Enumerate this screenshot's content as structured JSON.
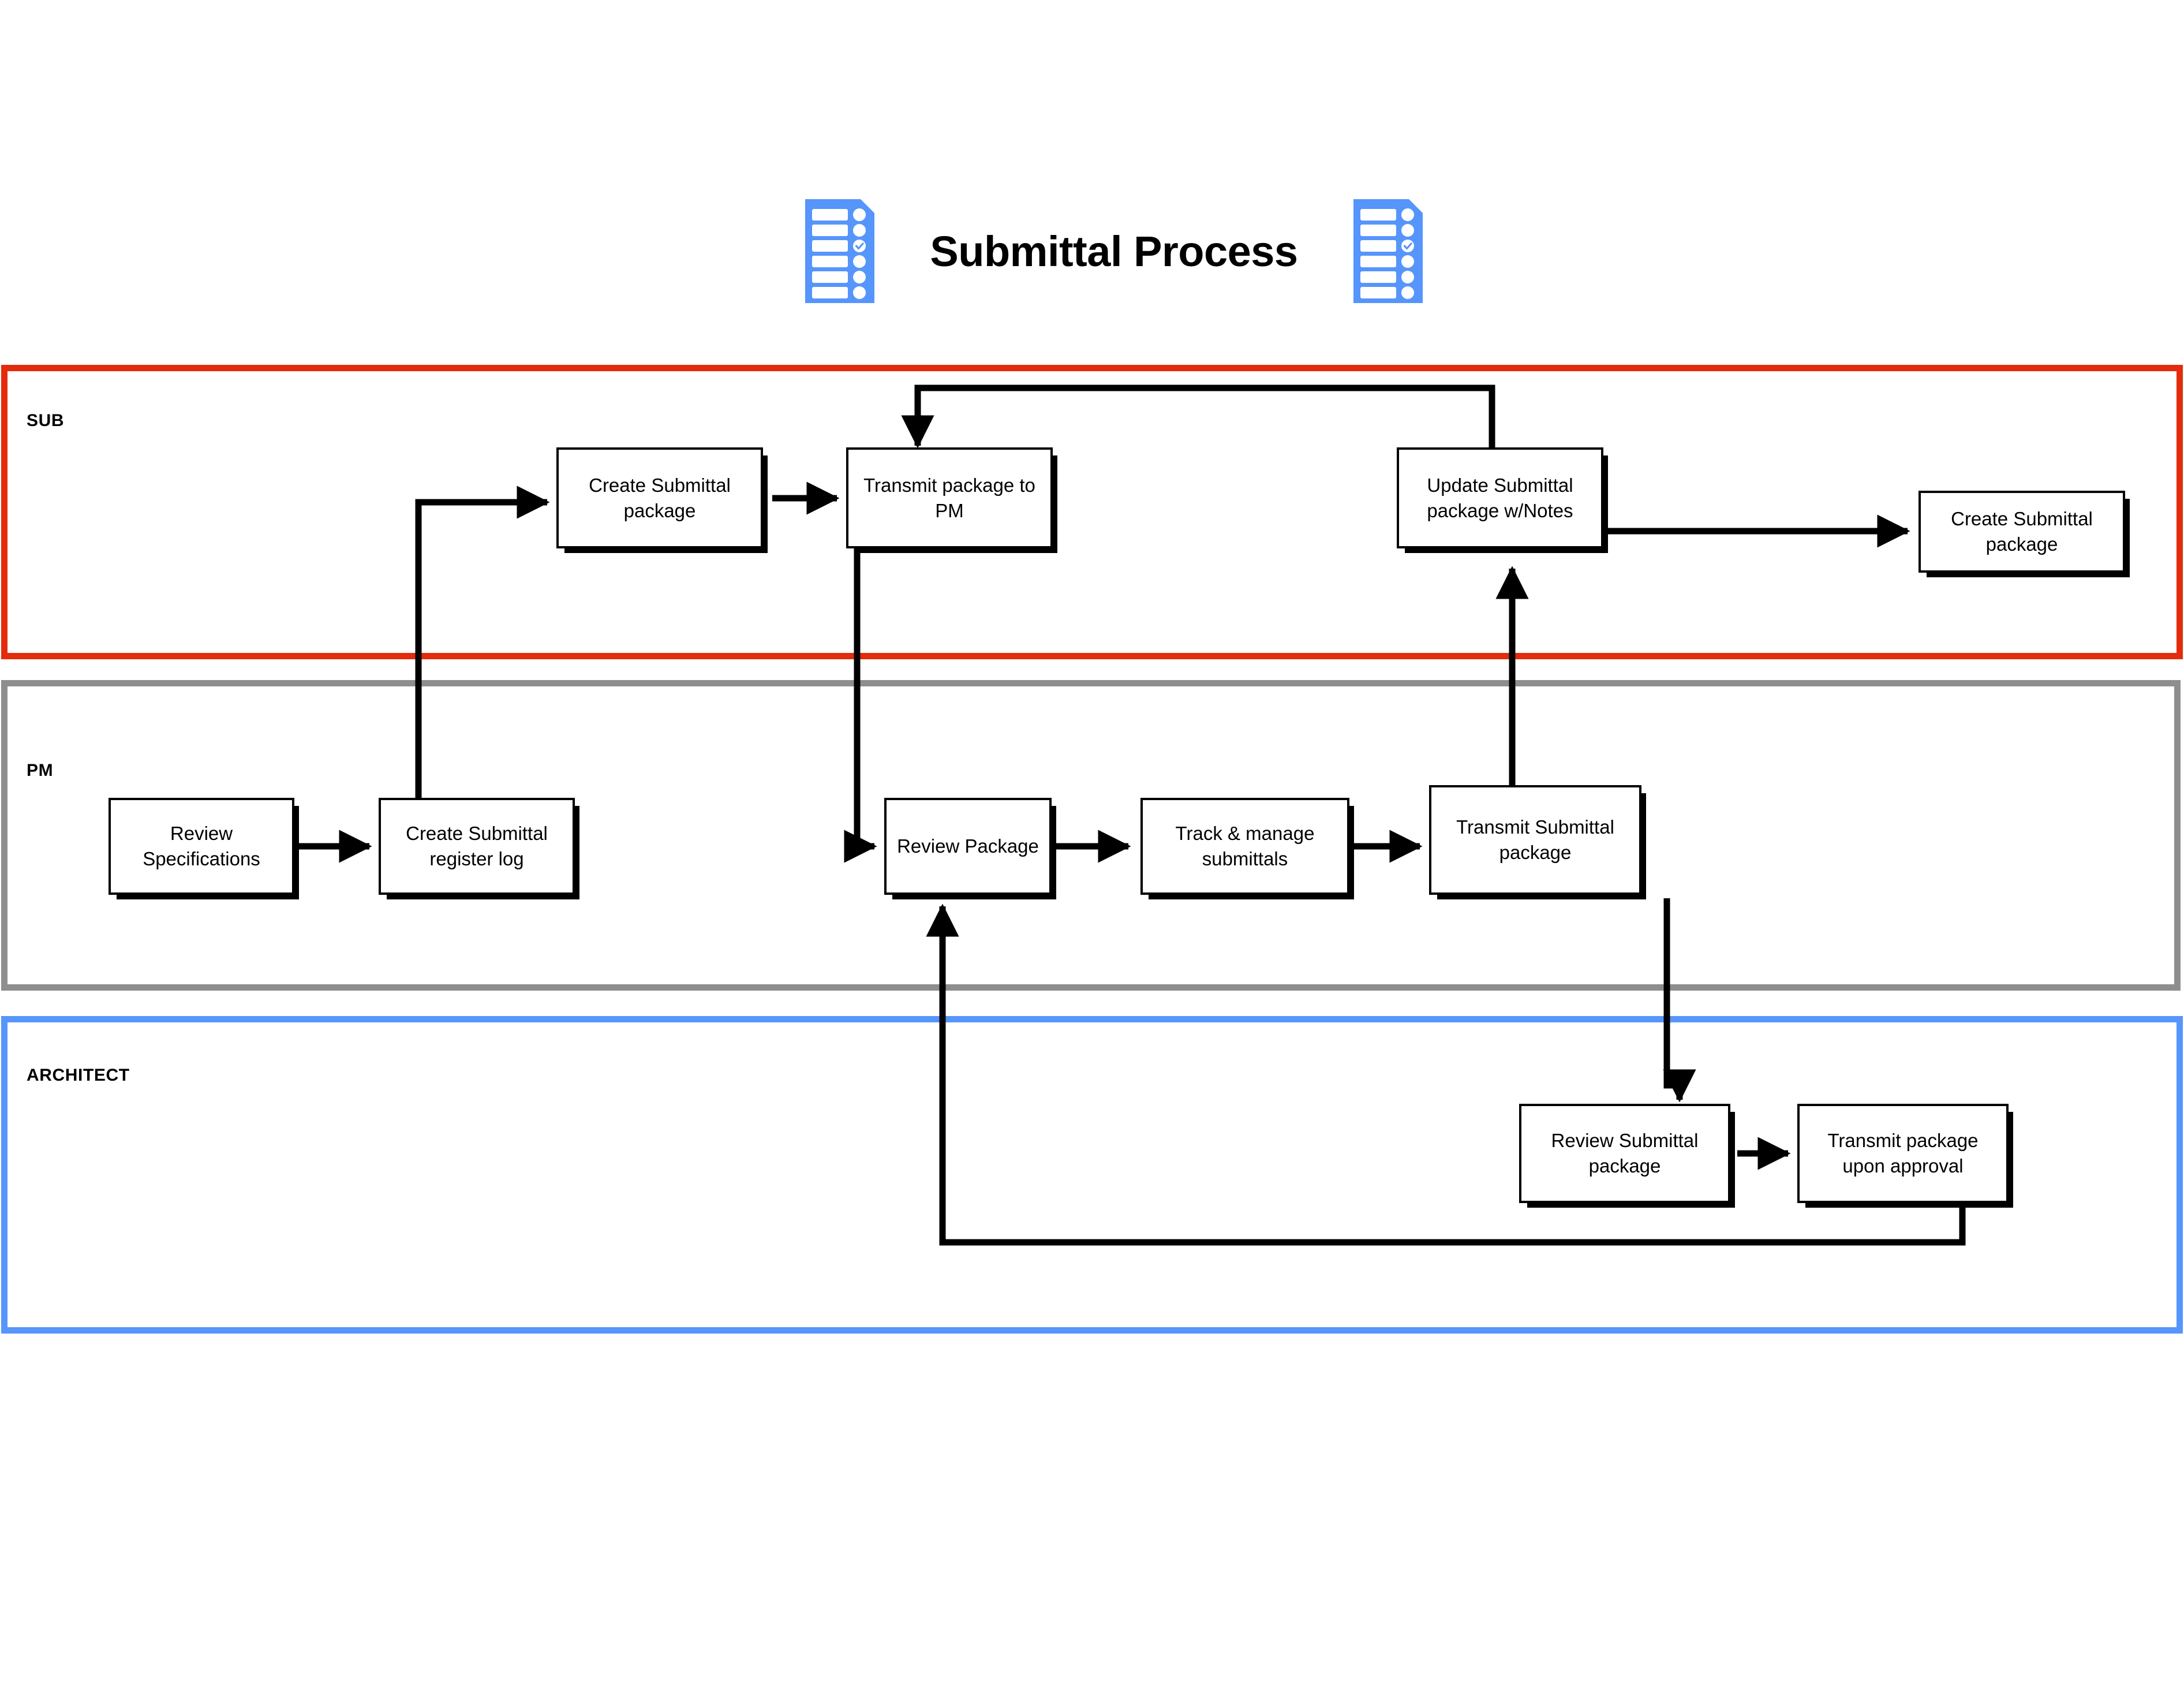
{
  "header": {
    "title": "Submittal Process",
    "left_icon": "checklist-document-icon",
    "right_icon": "checklist-document-icon"
  },
  "colors": {
    "sub_lane_border": "#E32C0C",
    "pm_lane_border": "#8E8E8E",
    "architect_lane_border": "#5695FB",
    "icon_blue": "#5695FB",
    "node_border": "#000000",
    "connector": "#000000",
    "canvas": "#FFFFFF"
  },
  "lanes": [
    {
      "id": "sub",
      "label": "SUB"
    },
    {
      "id": "pm",
      "label": "PM"
    },
    {
      "id": "architect",
      "label": "ARCHITECT"
    }
  ],
  "nodes": {
    "sub_create_package": "Create Submittal package",
    "sub_transmit_to_pm": "Transmit package to PM",
    "sub_update_notes": "Update Submittal package w/Notes",
    "sub_create_package_2": "Create Submittal package",
    "pm_review_specs": "Review Specifications",
    "pm_create_register": "Create Submittal register log",
    "pm_review_package": "Review Package",
    "pm_track_manage": "Track & manage submittals",
    "pm_transmit_package": "Transmit Submittal package",
    "arch_review_package": "Review Submittal package",
    "arch_transmit_approval": "Transmit package upon approval"
  },
  "flow_edges": [
    {
      "from": "pm_create_register",
      "to": "sub_create_package",
      "kind": "up-then-right"
    },
    {
      "from": "sub_create_package",
      "to": "sub_transmit_to_pm",
      "kind": "right"
    },
    {
      "from": "sub_transmit_to_pm",
      "to": "pm_review_package",
      "kind": "down-then-right"
    },
    {
      "from": "sub_update_notes",
      "to": "sub_transmit_to_pm",
      "kind": "up-left-down-loop"
    },
    {
      "from": "sub_update_notes",
      "to": "sub_create_package_2",
      "kind": "right"
    },
    {
      "from": "pm_review_specs",
      "to": "pm_create_register",
      "kind": "right"
    },
    {
      "from": "pm_review_package",
      "to": "pm_track_manage",
      "kind": "right"
    },
    {
      "from": "pm_track_manage",
      "to": "pm_transmit_package",
      "kind": "right"
    },
    {
      "from": "pm_transmit_package",
      "to": "arch_review_package",
      "kind": "down"
    },
    {
      "from": "pm_transmit_package",
      "to": "sub_update_notes",
      "kind": "up"
    },
    {
      "from": "arch_review_package",
      "to": "arch_transmit_approval",
      "kind": "right"
    },
    {
      "from": "arch_transmit_approval",
      "to": "pm_review_package",
      "kind": "down-left-up-loop"
    }
  ]
}
